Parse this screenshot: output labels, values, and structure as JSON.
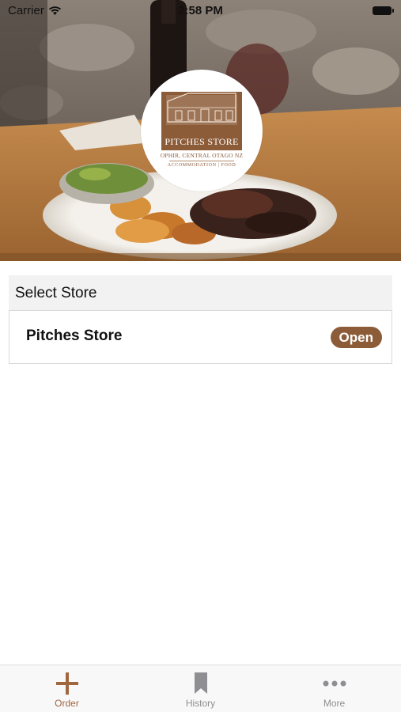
{
  "status_bar": {
    "carrier": "Carrier",
    "time": "2:58 PM"
  },
  "logo": {
    "name": "PITCHES STORE",
    "location": "OPHIR, CENTRAL OTAGO NZ",
    "tagline": "ACCOMMODATION | FOOD"
  },
  "store_select": {
    "title": "Select Store",
    "stores": [
      {
        "name": "Pitches Store",
        "status": "Open"
      }
    ]
  },
  "tab_bar": {
    "tabs": [
      {
        "label": "Order",
        "icon": "plus-icon",
        "active": true
      },
      {
        "label": "History",
        "icon": "bookmark-icon",
        "active": false
      },
      {
        "label": "More",
        "icon": "more-dots-icon",
        "active": false
      }
    ]
  },
  "colors": {
    "accent": "#8c5c39",
    "tab_active": "#a0663d",
    "tab_inactive": "#8e8e93"
  }
}
